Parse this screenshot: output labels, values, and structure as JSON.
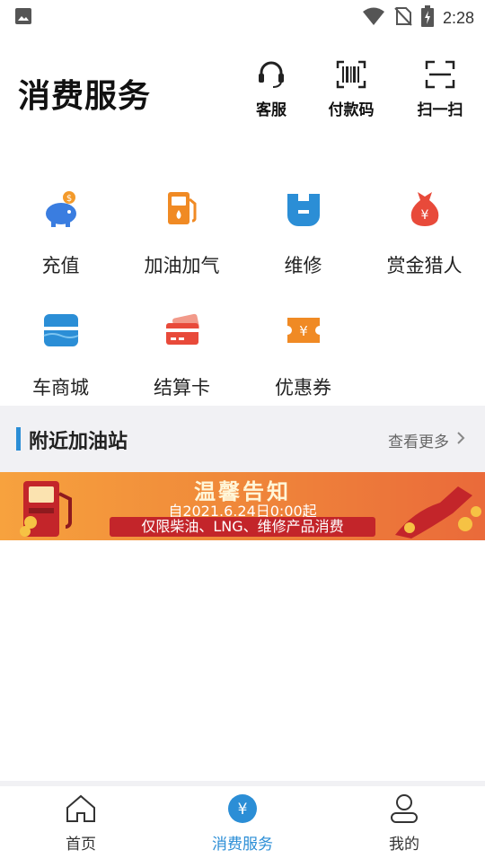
{
  "status_bar": {
    "time": "2:28"
  },
  "header": {
    "title": "消费服务",
    "buttons": [
      {
        "label": "客服",
        "icon": "headset-icon"
      },
      {
        "label": "付款码",
        "icon": "barcode-icon"
      },
      {
        "label": "扫一扫",
        "icon": "scan-icon"
      }
    ]
  },
  "services": [
    {
      "label": "充值",
      "icon": "piggy-bank-icon",
      "color": "#3a7de0"
    },
    {
      "label": "加油加气",
      "icon": "fuel-pump-icon",
      "color": "#f08a24"
    },
    {
      "label": "维修",
      "icon": "repair-icon",
      "color": "#2b8ed6"
    },
    {
      "label": "赏金猎人",
      "icon": "money-bag-icon",
      "color": "#e84a3a"
    },
    {
      "label": "车商城",
      "icon": "shop-icon",
      "color": "#2b8ed6"
    },
    {
      "label": "结算卡",
      "icon": "card-icon",
      "color": "#e84a3a"
    },
    {
      "label": "优惠券",
      "icon": "coupon-icon",
      "color": "#f08a24"
    }
  ],
  "nearby": {
    "title": "附近加油站",
    "more": "查看更多"
  },
  "banner": {
    "title": "温馨告知",
    "subtitle": "自2021.6.24日0:00起",
    "strip": "仅限柴油、LNG、维修产品消费"
  },
  "tabbar": [
    {
      "label": "首页",
      "icon": "home-icon",
      "active": false
    },
    {
      "label": "消费服务",
      "icon": "yuan-icon",
      "active": true
    },
    {
      "label": "我的",
      "icon": "user-icon",
      "active": false
    }
  ],
  "colors": {
    "accent": "#2b8ed6",
    "section_bg": "#f1f1f4"
  }
}
